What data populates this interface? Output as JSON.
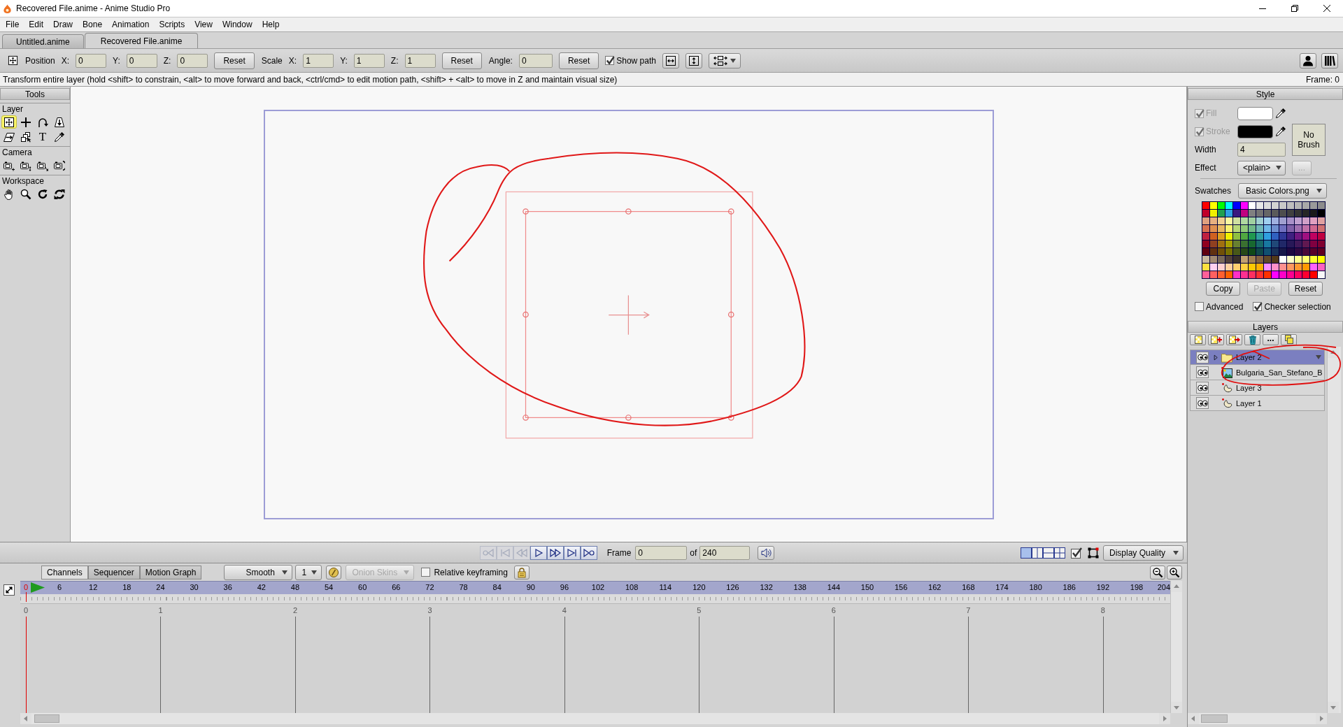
{
  "window": {
    "title": "Recovered File.anime - Anime Studio Pro"
  },
  "menu": [
    "File",
    "Edit",
    "Draw",
    "Bone",
    "Animation",
    "Scripts",
    "View",
    "Window",
    "Help"
  ],
  "document_tabs": [
    {
      "label": "Untitled.anime",
      "selected": false
    },
    {
      "label": "Recovered File.anime",
      "selected": true
    }
  ],
  "toolbar": {
    "position": {
      "label": "Position",
      "fields": [
        {
          "label": "X:",
          "value": "0"
        },
        {
          "label": "Y:",
          "value": "0"
        },
        {
          "label": "Z:",
          "value": "0"
        }
      ],
      "reset": "Reset"
    },
    "scale": {
      "label": "Scale",
      "fields": [
        {
          "label": "X:",
          "value": "1"
        },
        {
          "label": "Y:",
          "value": "1"
        },
        {
          "label": "Z:",
          "value": "1"
        }
      ],
      "reset": "Reset"
    },
    "angle": {
      "label": "Angle:",
      "value": "0",
      "reset": "Reset"
    },
    "show_path": {
      "label": "Show path",
      "checked": true
    }
  },
  "status_bar": {
    "hint": "Transform entire layer (hold <shift> to constrain, <alt> to move forward and back, <ctrl/cmd> to edit motion path, <shift> + <alt> to move in Z and maintain visual size)",
    "frame": "Frame: 0"
  },
  "tools": {
    "title": "Tools",
    "groups": [
      {
        "label": "Layer",
        "tools": [
          {
            "selected": true
          },
          {
            "selected": false
          },
          {
            "selected": false
          },
          {
            "selected": false
          },
          {
            "selected": false
          },
          {
            "selected": false
          },
          {
            "selected": false,
            "glyph": "T"
          },
          {
            "selected": false
          }
        ]
      },
      {
        "label": "Camera",
        "tools": [
          {
            "selected": false
          },
          {
            "selected": false
          },
          {
            "selected": false
          },
          {
            "selected": false
          }
        ]
      },
      {
        "label": "Workspace",
        "tools": [
          {
            "selected": false
          },
          {
            "selected": false
          },
          {
            "selected": false
          },
          {
            "selected": false
          }
        ]
      }
    ]
  },
  "playback": {
    "buttons": [
      {
        "disabled": true
      },
      {
        "disabled": true
      },
      {
        "disabled": true
      },
      {
        "disabled": false
      },
      {
        "disabled": false
      },
      {
        "disabled": false
      },
      {
        "disabled": false
      }
    ],
    "frame_label": "Frame",
    "frame": "0",
    "of_label": "of",
    "total": "240",
    "view_layouts": [
      {
        "selected": true
      },
      {
        "selected": false
      },
      {
        "selected": false
      },
      {
        "selected": false
      }
    ],
    "check_toggle": {
      "checked": true
    },
    "display_quality": "Display Quality"
  },
  "timeline": {
    "tabs": [
      {
        "label": "Channels",
        "selected": true
      },
      {
        "label": "Sequencer",
        "selected": false
      },
      {
        "label": "Motion Graph",
        "selected": false
      }
    ],
    "interpolation": "Smooth",
    "step": "1",
    "onion_skins": {
      "label": "Onion Skins",
      "disabled": true
    },
    "relative_keyframing": {
      "label": "Relative keyframing",
      "checked": false
    },
    "frame_labels": [
      {
        "label": "0",
        "current": true
      },
      {
        "label": "6",
        "current": false
      },
      {
        "label": "12",
        "current": false
      },
      {
        "label": "18",
        "current": false
      },
      {
        "label": "24",
        "current": false
      },
      {
        "label": "30",
        "current": false
      },
      {
        "label": "36",
        "current": false
      },
      {
        "label": "42",
        "current": false
      },
      {
        "label": "48",
        "current": false
      },
      {
        "label": "54",
        "current": false
      },
      {
        "label": "60",
        "current": false
      },
      {
        "label": "66",
        "current": false
      },
      {
        "label": "72",
        "current": false
      },
      {
        "label": "78",
        "current": false
      },
      {
        "label": "84",
        "current": false
      },
      {
        "label": "90",
        "current": false
      },
      {
        "label": "96",
        "current": false
      },
      {
        "label": "102",
        "current": false
      },
      {
        "label": "108",
        "current": false
      },
      {
        "label": "114",
        "current": false
      },
      {
        "label": "120",
        "current": false
      },
      {
        "label": "126",
        "current": false
      },
      {
        "label": "132",
        "current": false
      },
      {
        "label": "138",
        "current": false
      },
      {
        "label": "144",
        "current": false
      },
      {
        "label": "150",
        "current": false
      },
      {
        "label": "156",
        "current": false
      },
      {
        "label": "162",
        "current": false
      },
      {
        "label": "168",
        "current": false
      },
      {
        "label": "174",
        "current": false
      },
      {
        "label": "180",
        "current": false
      },
      {
        "label": "186",
        "current": false
      },
      {
        "label": "192",
        "current": false
      },
      {
        "label": "198",
        "current": false
      },
      {
        "label": "204",
        "current": false
      }
    ],
    "second_labels": [
      "0",
      "1",
      "2",
      "3",
      "4",
      "5",
      "6",
      "7",
      "8"
    ]
  },
  "style": {
    "title": "Style",
    "fill": {
      "label": "Fill",
      "checked": true,
      "disabled": true,
      "color": "#ffffff"
    },
    "stroke": {
      "label": "Stroke",
      "checked": true,
      "disabled": true,
      "color": "#000000"
    },
    "brush": "No Brush",
    "width": {
      "label": "Width",
      "value": "4"
    },
    "effect": {
      "label": "Effect",
      "value": "<plain>"
    },
    "effect_button": {
      "label": "...",
      "disabled": true
    },
    "swatches": {
      "label": "Swatches",
      "value": "Basic Colors.png",
      "colors": [
        {
          "color": "#ff0000"
        },
        {
          "color": "#ffff00"
        },
        {
          "color": "#00ff00"
        },
        {
          "color": "#00ffff"
        },
        {
          "color": "#0000ff"
        },
        {
          "color": "#ff00ff"
        },
        {
          "color": "#ffffff"
        },
        {
          "color": "#e8e8e8"
        },
        {
          "color": "#dcdcdc"
        },
        {
          "color": "#d2d2d2"
        },
        {
          "color": "#c8c8c8"
        },
        {
          "color": "#bebebe"
        },
        {
          "color": "#b4b4b4"
        },
        {
          "color": "#a8a8a8"
        },
        {
          "color": "#9a9a9a"
        },
        {
          "color": "#8c8c8c"
        },
        {
          "color": "#c0002a"
        },
        {
          "color": "#f0f000"
        },
        {
          "color": "#20a050"
        },
        {
          "color": "#30a0e0"
        },
        {
          "color": "#3a1a80"
        },
        {
          "color": "#c00080"
        },
        {
          "color": "#808080"
        },
        {
          "color": "#737373"
        },
        {
          "color": "#666666"
        },
        {
          "color": "#5a5a5a"
        },
        {
          "color": "#4d4d4d"
        },
        {
          "color": "#404040"
        },
        {
          "color": "#333333"
        },
        {
          "color": "#262626"
        },
        {
          "color": "#1a1a1a"
        },
        {
          "color": "#000000"
        },
        {
          "color": "#e0a080"
        },
        {
          "color": "#e8b080"
        },
        {
          "color": "#f0d090"
        },
        {
          "color": "#f8f8a0"
        },
        {
          "color": "#d0e0a0"
        },
        {
          "color": "#b0d8a0"
        },
        {
          "color": "#a0d0a0"
        },
        {
          "color": "#a0d0d0"
        },
        {
          "color": "#a0d0f0"
        },
        {
          "color": "#a0b0e0"
        },
        {
          "color": "#a0a0d0"
        },
        {
          "color": "#a890c8"
        },
        {
          "color": "#c0a0d0"
        },
        {
          "color": "#d0a0c8"
        },
        {
          "color": "#e0a0c0"
        },
        {
          "color": "#e0a0a0"
        },
        {
          "color": "#d87050"
        },
        {
          "color": "#e09050"
        },
        {
          "color": "#e8b860"
        },
        {
          "color": "#f8f070"
        },
        {
          "color": "#b8d878"
        },
        {
          "color": "#90c878"
        },
        {
          "color": "#70b888"
        },
        {
          "color": "#70b8b8"
        },
        {
          "color": "#70b8e8"
        },
        {
          "color": "#7090d0"
        },
        {
          "color": "#7070c0"
        },
        {
          "color": "#8060a8"
        },
        {
          "color": "#a070b0"
        },
        {
          "color": "#c070a8"
        },
        {
          "color": "#d06890"
        },
        {
          "color": "#d07070"
        },
        {
          "color": "#c02040"
        },
        {
          "color": "#d06020"
        },
        {
          "color": "#e0a020"
        },
        {
          "color": "#f0f000"
        },
        {
          "color": "#90c040"
        },
        {
          "color": "#50a840"
        },
        {
          "color": "#209850"
        },
        {
          "color": "#30a0a0"
        },
        {
          "color": "#30a0e0"
        },
        {
          "color": "#3060c0"
        },
        {
          "color": "#303898"
        },
        {
          "color": "#402080"
        },
        {
          "color": "#701880"
        },
        {
          "color": "#a01080"
        },
        {
          "color": "#c00060"
        },
        {
          "color": "#c00040"
        },
        {
          "color": "#900020"
        },
        {
          "color": "#904020"
        },
        {
          "color": "#a07010"
        },
        {
          "color": "#a8a000"
        },
        {
          "color": "#688030"
        },
        {
          "color": "#3a7030"
        },
        {
          "color": "#186830"
        },
        {
          "color": "#186868"
        },
        {
          "color": "#1878a0"
        },
        {
          "color": "#204878"
        },
        {
          "color": "#202868"
        },
        {
          "color": "#281858"
        },
        {
          "color": "#401858"
        },
        {
          "color": "#601850"
        },
        {
          "color": "#800040"
        },
        {
          "color": "#800030"
        },
        {
          "color": "#600010"
        },
        {
          "color": "#603010"
        },
        {
          "color": "#705008"
        },
        {
          "color": "#787000"
        },
        {
          "color": "#485818"
        },
        {
          "color": "#284818"
        },
        {
          "color": "#104818"
        },
        {
          "color": "#104848"
        },
        {
          "color": "#105070"
        },
        {
          "color": "#183058"
        },
        {
          "color": "#181848"
        },
        {
          "color": "#200840"
        },
        {
          "color": "#300840"
        },
        {
          "color": "#480838"
        },
        {
          "color": "#580028"
        },
        {
          "color": "#600020"
        },
        {
          "color": "#c8b8a0"
        },
        {
          "color": "#a08870"
        },
        {
          "color": "#786858"
        },
        {
          "color": "#504038"
        },
        {
          "color": "#383028"
        },
        {
          "color": "#c0a070"
        },
        {
          "color": "#a08050"
        },
        {
          "color": "#806040"
        },
        {
          "color": "#604828"
        },
        {
          "color": "#503818"
        },
        {
          "color": "#ffffff"
        },
        {
          "color": "#ffffc8"
        },
        {
          "color": "#ffff90"
        },
        {
          "color": "#ffff70"
        },
        {
          "color": "#ffff30"
        },
        {
          "color": "#ffff00"
        },
        {
          "color": "#ffe040"
        },
        {
          "color": "#ffd0f0"
        },
        {
          "color": "#ffd0d0"
        },
        {
          "color": "#ffd0a0"
        },
        {
          "color": "#ffd070"
        },
        {
          "color": "#ffd040"
        },
        {
          "color": "#ffc800"
        },
        {
          "color": "#ffb000"
        },
        {
          "color": "#ff90ff"
        },
        {
          "color": "#ff90c8"
        },
        {
          "color": "#ff9090"
        },
        {
          "color": "#ff9860"
        },
        {
          "color": "#ff9830"
        },
        {
          "color": "#ff9800"
        },
        {
          "color": "#ff60ff"
        },
        {
          "color": "#ff60c0"
        },
        {
          "color": "#ff6098"
        },
        {
          "color": "#ff6060"
        },
        {
          "color": "#ff6030"
        },
        {
          "color": "#ff6000"
        },
        {
          "color": "#ff30c8"
        },
        {
          "color": "#ff3090"
        },
        {
          "color": "#ff3060"
        },
        {
          "color": "#ff3030"
        },
        {
          "color": "#ff3000"
        },
        {
          "color": "#ff00ff"
        },
        {
          "color": "#ff00c8"
        },
        {
          "color": "#ff0090"
        },
        {
          "color": "#ff0060"
        },
        {
          "color": "#ff0030"
        },
        {
          "color": "#ff0000"
        },
        {
          "color": "#f8f8f8"
        }
      ]
    },
    "buttons": [
      {
        "label": "Copy",
        "disabled": false
      },
      {
        "label": "Paste",
        "disabled": true
      },
      {
        "label": "Reset",
        "disabled": false
      }
    ],
    "advanced": {
      "label": "Advanced",
      "checked": false
    },
    "checker_selection": {
      "label": "Checker selection",
      "checked": true
    }
  },
  "layers": {
    "title": "Layers",
    "more_button": "...",
    "items": [
      {
        "name": "Layer 2",
        "kind": "group",
        "selected": true,
        "visible": true,
        "expanded": false
      },
      {
        "name": "Bulgaria_San_Stefano_B",
        "kind": "image",
        "selected": false,
        "visible": true
      },
      {
        "name": "Layer 3",
        "kind": "vector",
        "selected": false,
        "visible": true
      },
      {
        "name": "Layer 1",
        "kind": "vector",
        "selected": false,
        "visible": true
      }
    ]
  }
}
